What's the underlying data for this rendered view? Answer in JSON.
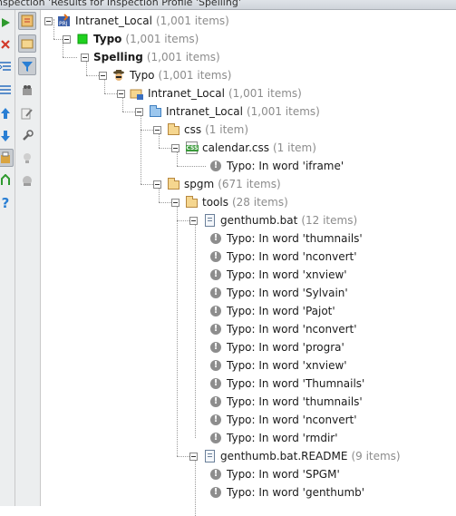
{
  "window": {
    "title": "nspection 'Results for Inspection Profile 'Spelling'"
  },
  "toolbar": {
    "left_icons": [
      "run-icon",
      "close-icon",
      "expand-all-icon",
      "collapse-all-icon",
      "up-icon",
      "down-icon",
      "export-icon",
      "apply-fix-icon",
      "help-icon"
    ],
    "right_icons": [
      "group-by-severity-icon",
      "group-by-directory-icon",
      "filter-icon",
      "autoscroll-icon",
      "edit-settings-icon",
      "quickfix-icon",
      "lightbulb-icon",
      "suppress-icon"
    ]
  },
  "tree": [
    {
      "label": "Intranet_Local",
      "count": "(1,001 items)",
      "icon": "project-icon",
      "bold": false
    },
    {
      "label": "Typo",
      "count": "(1,001 items)",
      "icon": "green-square-icon",
      "bold": true
    },
    {
      "label": "Spelling",
      "count": "(1,001 items)",
      "icon": "none",
      "bold": true
    },
    {
      "label": "Typo",
      "count": "(1,001 items)",
      "icon": "inspector-icon",
      "bold": false
    },
    {
      "label": "Intranet_Local",
      "count": "(1,001 items)",
      "icon": "module-icon",
      "bold": false
    },
    {
      "label": "Intranet_Local",
      "count": "(1,001 items)",
      "icon": "blue-folder-icon",
      "bold": false
    },
    {
      "label": "css",
      "count": "(1 item)",
      "icon": "folder-icon",
      "bold": false
    },
    {
      "label": "calendar.css",
      "count": "(1 item)",
      "icon": "css-file-icon",
      "bold": false
    },
    {
      "label": "Typo: In word 'iframe'",
      "count": "",
      "icon": "warning-icon",
      "bold": false
    },
    {
      "label": "spgm",
      "count": "(671 items)",
      "icon": "folder-icon",
      "bold": false
    },
    {
      "label": "tools",
      "count": "(28 items)",
      "icon": "folder-icon",
      "bold": false
    },
    {
      "label": "genthumb.bat",
      "count": "(12 items)",
      "icon": "text-file-icon",
      "bold": false
    },
    {
      "label": "Typo: In word 'thumnails'",
      "count": "",
      "icon": "warning-icon",
      "bold": false
    },
    {
      "label": "Typo: In word 'nconvert'",
      "count": "",
      "icon": "warning-icon",
      "bold": false
    },
    {
      "label": "Typo: In word 'xnview'",
      "count": "",
      "icon": "warning-icon",
      "bold": false
    },
    {
      "label": "Typo: In word 'Sylvain'",
      "count": "",
      "icon": "warning-icon",
      "bold": false
    },
    {
      "label": "Typo: In word 'Pajot'",
      "count": "",
      "icon": "warning-icon",
      "bold": false
    },
    {
      "label": "Typo: In word 'nconvert'",
      "count": "",
      "icon": "warning-icon",
      "bold": false
    },
    {
      "label": "Typo: In word 'progra'",
      "count": "",
      "icon": "warning-icon",
      "bold": false
    },
    {
      "label": "Typo: In word 'xnview'",
      "count": "",
      "icon": "warning-icon",
      "bold": false
    },
    {
      "label": "Typo: In word 'Thumnails'",
      "count": "",
      "icon": "warning-icon",
      "bold": false
    },
    {
      "label": "Typo: In word 'thumnails'",
      "count": "",
      "icon": "warning-icon",
      "bold": false
    },
    {
      "label": "Typo: In word 'nconvert'",
      "count": "",
      "icon": "warning-icon",
      "bold": false
    },
    {
      "label": "Typo: In word 'rmdir'",
      "count": "",
      "icon": "warning-icon",
      "bold": false
    },
    {
      "label": "genthumb.bat.README",
      "count": "(9 items)",
      "icon": "text-file-icon",
      "bold": false
    },
    {
      "label": "Typo: In word 'SPGM'",
      "count": "",
      "icon": "warning-icon",
      "bold": false
    },
    {
      "label": "Typo: In word 'genthumb'",
      "count": "",
      "icon": "warning-icon",
      "bold": false
    }
  ]
}
